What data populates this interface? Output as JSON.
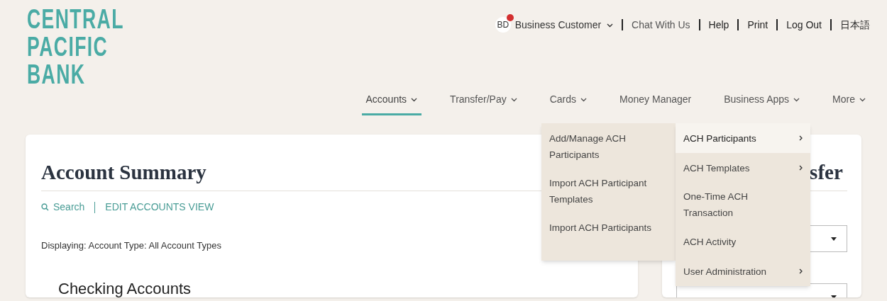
{
  "logo": {
    "lines": [
      "CENTRAL",
      "PACIFIC",
      "BANK"
    ]
  },
  "user_menu": {
    "initials": "BD",
    "notification": true,
    "name": "Business Customer"
  },
  "top_links": [
    "Chat With Us",
    "Help",
    "Print",
    "Log Out",
    "日本語"
  ],
  "nav": [
    {
      "label": "Accounts",
      "dropdown": true,
      "selected": true
    },
    {
      "label": "Transfer/Pay",
      "dropdown": true,
      "selected": false
    },
    {
      "label": "Cards",
      "dropdown": true,
      "selected": false
    },
    {
      "label": "Money Manager",
      "dropdown": false,
      "selected": false
    },
    {
      "label": "Business Apps",
      "dropdown": true,
      "selected": false
    },
    {
      "label": "More",
      "dropdown": true,
      "selected": false
    }
  ],
  "summary": {
    "title": "Account Summary",
    "search": "Search",
    "edit": "EDIT ACCOUNTS VIEW",
    "displaying": "Displaying: Account Type: All Account Types",
    "section": "Checking Accounts"
  },
  "side_card": {
    "title": "sfer"
  },
  "menu": [
    {
      "label": "ACH Participants",
      "submenu": true,
      "selected": true
    },
    {
      "label": "ACH Templates",
      "submenu": true,
      "selected": false
    },
    {
      "label": "One-Time ACH Transaction",
      "submenu": false,
      "selected": false
    },
    {
      "label": "ACH Activity",
      "submenu": false,
      "selected": false
    },
    {
      "label": "User Administration",
      "submenu": true,
      "selected": false
    }
  ],
  "submenu": [
    "Add/Manage ACH Participants",
    "Import ACH Participant Templates",
    "Import ACH Participants"
  ]
}
